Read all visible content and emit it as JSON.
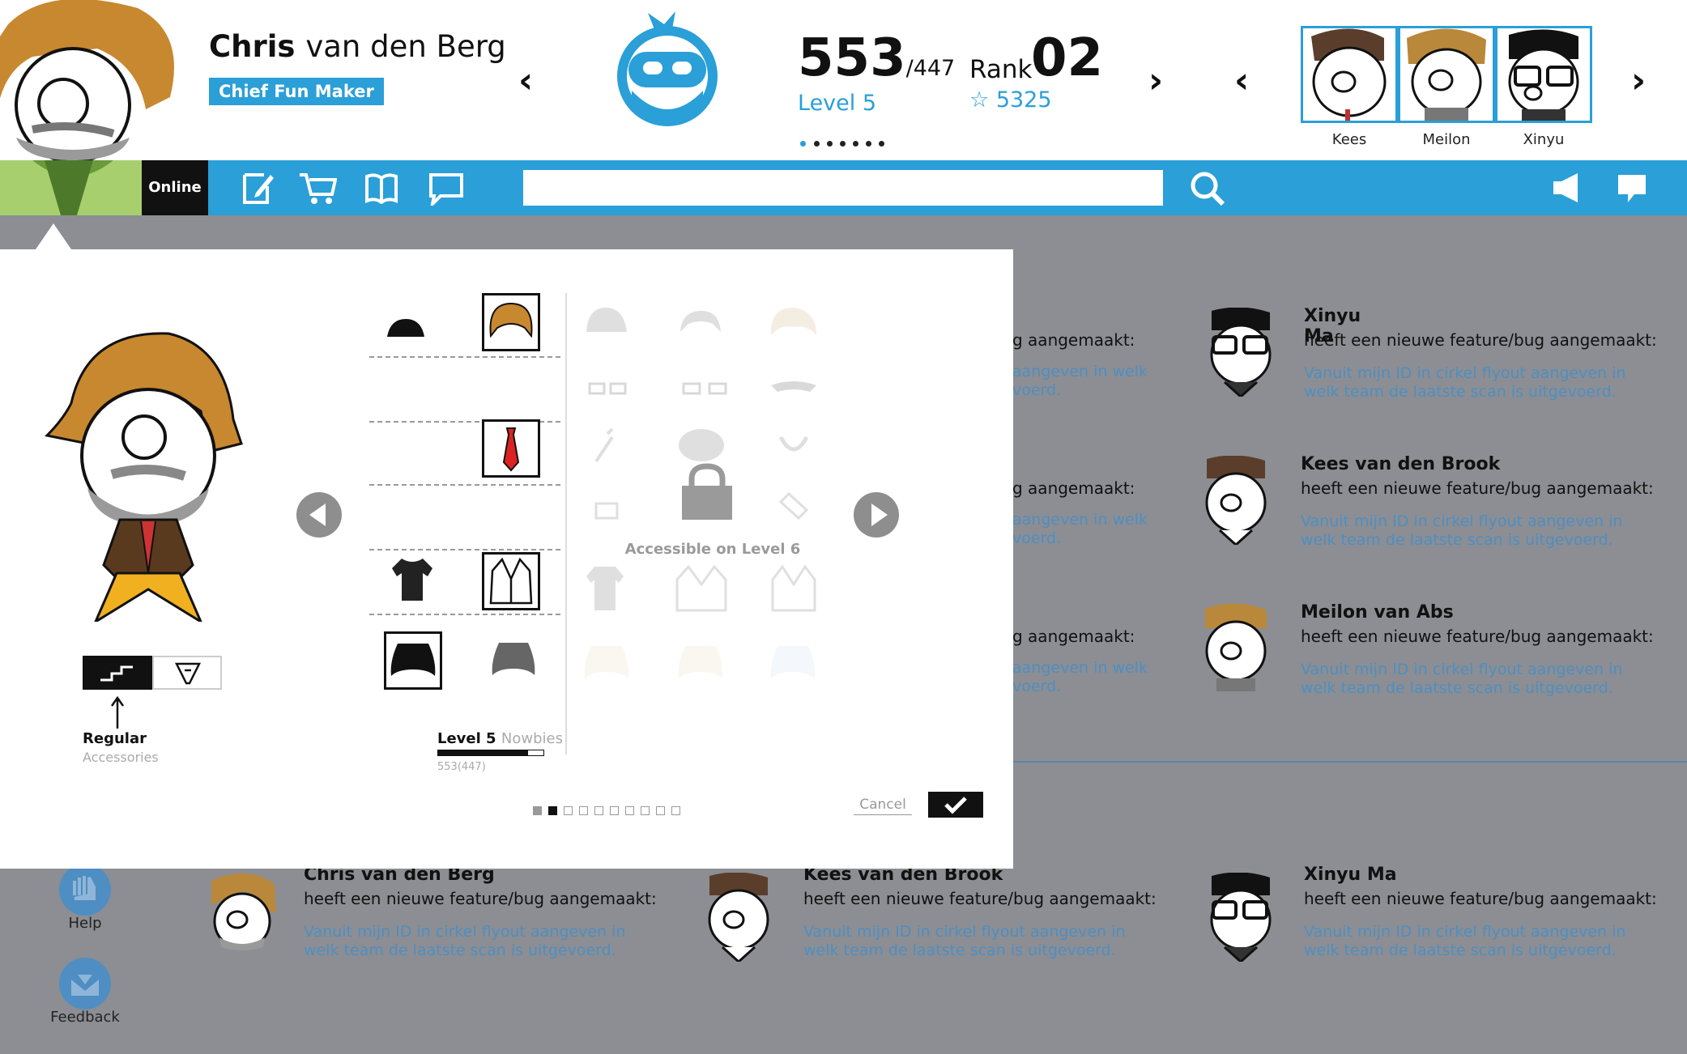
{
  "user": {
    "first_name": "Chris",
    "last_name": "van den Berg",
    "role": "Chief Fun Maker",
    "status": "Online"
  },
  "stats": {
    "points": "553",
    "points_next": "/447",
    "level": "Level 5",
    "rank_label": "Rank",
    "rank_value": "02",
    "stars": "5325"
  },
  "friends": [
    {
      "name": "Kees"
    },
    {
      "name": "Meilon"
    },
    {
      "name": "Xinyu"
    }
  ],
  "search": {
    "placeholder": ""
  },
  "feed": [
    {
      "name": "Xinyu Ma",
      "action": "heeft een nieuwe feature/bug aangemaakt:",
      "body": "Vanuit mijn ID in cirkel flyout aangeven in welk team de laatste scan is uitgevoerd."
    },
    {
      "name": "Kees van den Brook",
      "action": "heeft een nieuwe feature/bug aangemaakt:",
      "body": "Vanuit mijn ID in cirkel flyout aangeven in welk team de laatste scan is uitgevoerd."
    },
    {
      "name": "Meilon van Abs",
      "action": "heeft een nieuwe feature/bug aangemaakt:",
      "body": "Vanuit mijn ID in cirkel flyout aangeven in welk team de laatste scan is uitgevoerd."
    },
    {
      "name": "Chris van den Berg",
      "action": "heeft een nieuwe feature/bug aangemaakt:",
      "body": "Vanuit mijn ID in cirkel flyout aangeven in welk team de laatste scan is uitgevoerd."
    },
    {
      "name": "Kees van den Brook",
      "action": "heeft een nieuwe feature/bug aangemaakt:",
      "body": "Vanuit mijn ID in cirkel flyout aangeven in welk team de laatste scan is uitgevoerd."
    },
    {
      "name": "Xinyu Ma",
      "action": "heeft een nieuwe feature/bug aangemaakt:",
      "body": "Vanuit mijn ID in cirkel flyout aangeven in welk team de laatste scan is uitgevoerd."
    }
  ],
  "feed_fragments": {
    "action": "g aangemaakt:",
    "body_line1": "aangeven in welk",
    "body_line2": "voerd."
  },
  "sidebar": {
    "help": "Help",
    "feedback": "Feedback"
  },
  "modal": {
    "mode_label": "Regular",
    "mode_sub": "Accessories",
    "level_label": "Level 5",
    "level_group": "Nowbies",
    "level_progress_text": "553(447)",
    "level_progress": 0.85,
    "locked_text": "Accessible on Level 6",
    "cancel_label": "Cancel",
    "page_count": 10,
    "page_active": 1
  },
  "colors": {
    "accent": "#2a9fd8",
    "overlay": "#8c8e93",
    "avatar_green": "#a8cf6e"
  }
}
